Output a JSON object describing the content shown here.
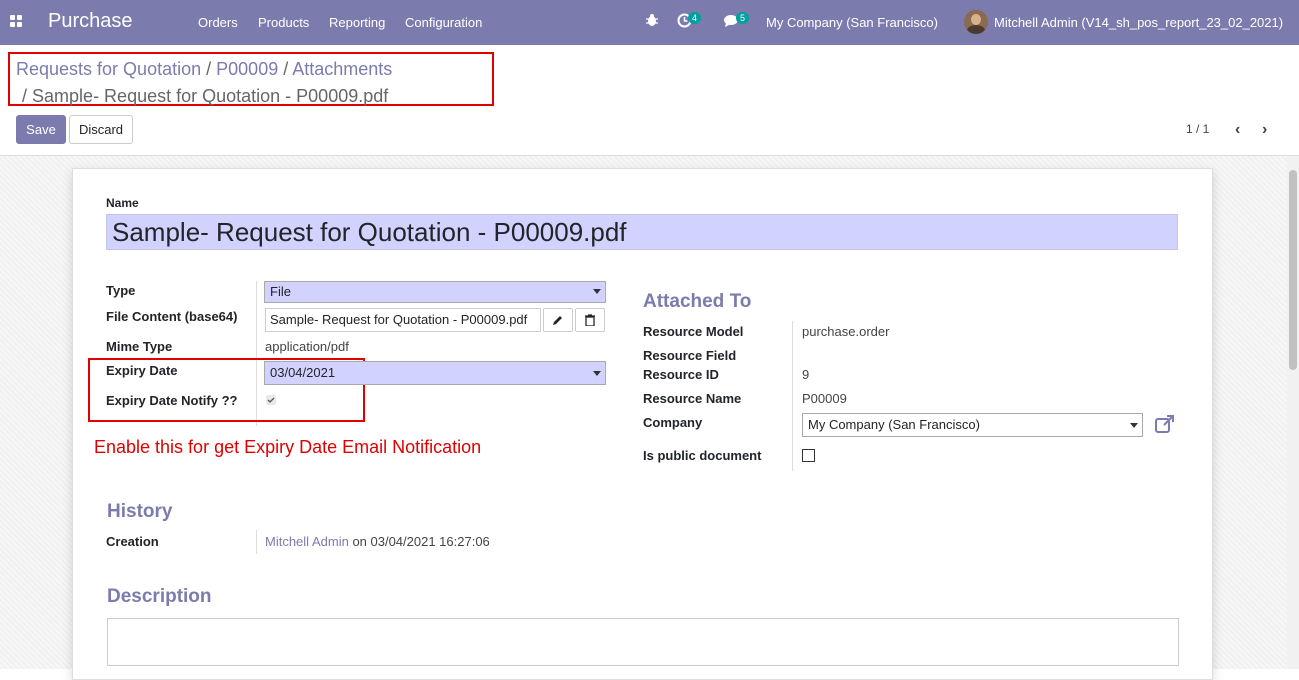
{
  "topbar": {
    "app_name": "Purchase",
    "menu": [
      "Orders",
      "Products",
      "Reporting",
      "Configuration"
    ],
    "activity_count": "4",
    "messages_count": "5",
    "company": "My Company (San Francisco)",
    "user": "Mitchell Admin (V14_sh_pos_report_23_02_2021)"
  },
  "breadcrumb": {
    "items": [
      "Requests for Quotation",
      "P00009",
      "Attachments"
    ],
    "separator": "/",
    "current": "Sample- Request for Quotation - P00009.pdf"
  },
  "actions": {
    "save": "Save",
    "discard": "Discard"
  },
  "pager": {
    "value": "1 / 1"
  },
  "form": {
    "name_label": "Name",
    "name_value": "Sample- Request for Quotation - P00009.pdf",
    "type_label": "Type",
    "type_value": "File",
    "file_content_label": "File Content (base64)",
    "file_content_value": "Sample- Request for Quotation - P00009.pdf",
    "mime_label": "Mime Type",
    "mime_value": "application/pdf",
    "expiry_label": "Expiry Date",
    "expiry_value": "03/04/2021",
    "notify_label": "Expiry Date Notify ??",
    "notify_checked": true,
    "annotation": "Enable this for get Expiry Date Email Notification"
  },
  "attached": {
    "title": "Attached To",
    "resource_model_label": "Resource Model",
    "resource_model_value": "purchase.order",
    "resource_field_label": "Resource Field",
    "resource_id_label": "Resource ID",
    "resource_id_value": "9",
    "resource_name_label": "Resource Name",
    "resource_name_value": "P00009",
    "company_label": "Company",
    "company_value": "My Company (San Francisco)",
    "public_label": "Is public document",
    "public_checked": false
  },
  "history": {
    "title": "History",
    "creation_label": "Creation",
    "creation_user": "Mitchell Admin",
    "creation_on": "on 03/04/2021 16:27:06"
  },
  "description": {
    "title": "Description"
  },
  "colors": {
    "brand": "#7c7bad",
    "annotation": "#e00000",
    "field_bg": "#d2d2ff"
  }
}
